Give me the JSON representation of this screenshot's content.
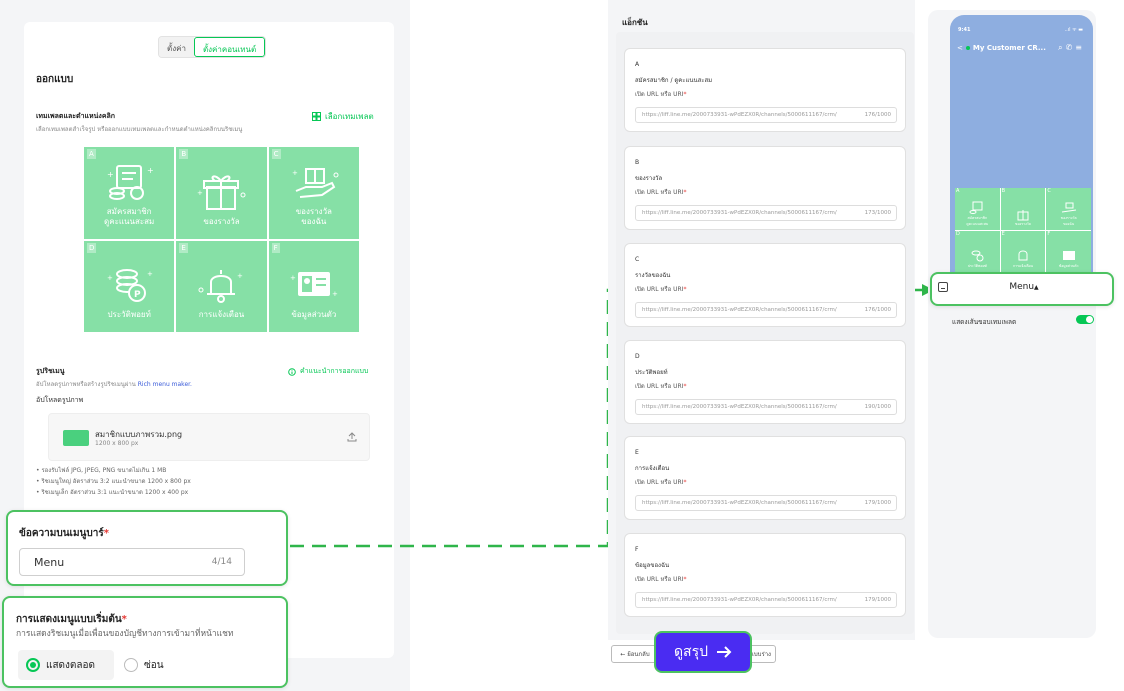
{
  "colors": {
    "brand": "#06c755",
    "highlight": "#4cc261",
    "menu_tile": "#86e0a6",
    "primary_button": "#4a2cf2",
    "phone_bg": "#8eaee0"
  },
  "left": {
    "tabs": [
      {
        "label": "ตั้งค่า"
      },
      {
        "label": "ตั้งค่าคอนเทนต์"
      }
    ],
    "section_title": "ออกแบบ",
    "template": {
      "title": "เทมเพลตและตำแหน่งคลิก",
      "desc": "เลือกเทมเพลตสำเร็จรูป หรือออกแบบเทมเพลตและกำหนดตำแหน่งคลิกบนริชเมนู",
      "action": "เลือกเทมเพลต",
      "action_icon": "template-icon"
    },
    "cells": [
      {
        "letter": "A",
        "label": "สมัครสมาชิก\nดูคะแนนสะสม",
        "icon": "member-card-coins-icon"
      },
      {
        "letter": "B",
        "label": "ของรางวัล",
        "icon": "gift-box-icon"
      },
      {
        "letter": "C",
        "label": "ของรางวัล\nของฉัน",
        "icon": "gift-hand-icon"
      },
      {
        "letter": "D",
        "label": "ประวัติพอยท์",
        "icon": "coins-points-icon"
      },
      {
        "letter": "E",
        "label": "การแจ้งเตือน",
        "icon": "bell-icon"
      },
      {
        "letter": "F",
        "label": "ข้อมูลส่วนตัว",
        "icon": "profile-card-icon"
      }
    ],
    "image": {
      "title": "รูปริชเมนู",
      "desc_prefix": "อัปโหลดรูปภาพหรือสร้างรูปริชเมนูผ่าน ",
      "desc_link": "Rich menu maker.",
      "guide": "คำแนะนำการออกแบบ",
      "upload_label": "อัปโหลดรูปภาพ",
      "file_name": "สมาชิกแบบภาพรวม.png",
      "file_size": "1200 x 800 px"
    },
    "notes": [
      "• รองรับไฟล์ JPG, JPEG, PNG ขนาดไม่เกิน 1 MB",
      "• ริชเมนูใหญ่ อัตราส่วน 3:2 แนะนำขนาด 1200 x 800 px",
      "• ริชเมนูเล็ก อัตราส่วน 3:1 แนะนำขนาด 1200 x 400 px"
    ]
  },
  "menubar_callout": {
    "label": "ข้อความบนเมนูบาร์",
    "required": "*",
    "value": "Menu",
    "counter": "4/14"
  },
  "default_callout": {
    "label": "การแสดงเมนูแบบเริ่มต้น",
    "required": "*",
    "desc": "การแสดงริชเมนูเมื่อเพื่อนของบัญชีทางการเข้ามาที่หน้าแชท",
    "options": [
      {
        "label": "แสดงตลอด",
        "selected": true
      },
      {
        "label": "ซ่อน",
        "selected": false
      }
    ]
  },
  "actions": {
    "title": "แอ็กชัน",
    "url_label": "เปิด URL หรือ URI",
    "required": "*",
    "items": [
      {
        "letter": "A",
        "name": "สมัครสมาชิก / ดูคะแนนสะสม",
        "url": "https://liff.line.me/2000733931-wPdEZX0R/channels/5000611167/crm/",
        "count": "176/1000"
      },
      {
        "letter": "B",
        "name": "ของรางวัล",
        "url": "https://liff.line.me/2000733931-wPdEZX0R/channels/5000611167/crm/",
        "count": "173/1000"
      },
      {
        "letter": "C",
        "name": "รางวัลของฉัน",
        "url": "https://liff.line.me/2000733931-wPdEZX0R/channels/5000611167/crm/",
        "count": "176/1000"
      },
      {
        "letter": "D",
        "name": "ประวัติพอยท์",
        "url": "https://liff.line.me/2000733931-wPdEZX0R/channels/5000611167/crm/",
        "count": "190/1000"
      },
      {
        "letter": "E",
        "name": "การแจ้งเตือน",
        "url": "https://liff.line.me/2000733931-wPdEZX0R/channels/5000611167/crm/",
        "count": "179/1000"
      },
      {
        "letter": "F",
        "name": "ข้อมูลของฉัน",
        "url": "https://liff.line.me/2000733931-wPdEZX0R/channels/5000611167/crm/",
        "count": "179/1000"
      }
    ],
    "back_label": "← ย้อนกลับ",
    "draft_label": "บันทึกแบบร่าง",
    "summary_label": "ดูสรุป",
    "summary_icon": "arrow-right-icon"
  },
  "phone": {
    "time": "9:41",
    "status": "..ıl ᯤ ▬",
    "chat_title": "My Customer CR...",
    "cells": [
      {
        "letter": "A",
        "label": "สมัครสมาชิก\nดูคะแนนสะสม"
      },
      {
        "letter": "B",
        "label": "ของรางวัล"
      },
      {
        "letter": "C",
        "label": "ของรางวัล\nของฉัน"
      },
      {
        "letter": "D",
        "label": "ประวัติพอยท์"
      },
      {
        "letter": "E",
        "label": "การแจ้งเตือน"
      },
      {
        "letter": "F",
        "label": "ข้อมูลส่วนตัว"
      }
    ],
    "menu_bar_label": "Menu",
    "show_border_label": "แสดงเส้นขอบเทมเพลต",
    "show_border_on": true
  }
}
